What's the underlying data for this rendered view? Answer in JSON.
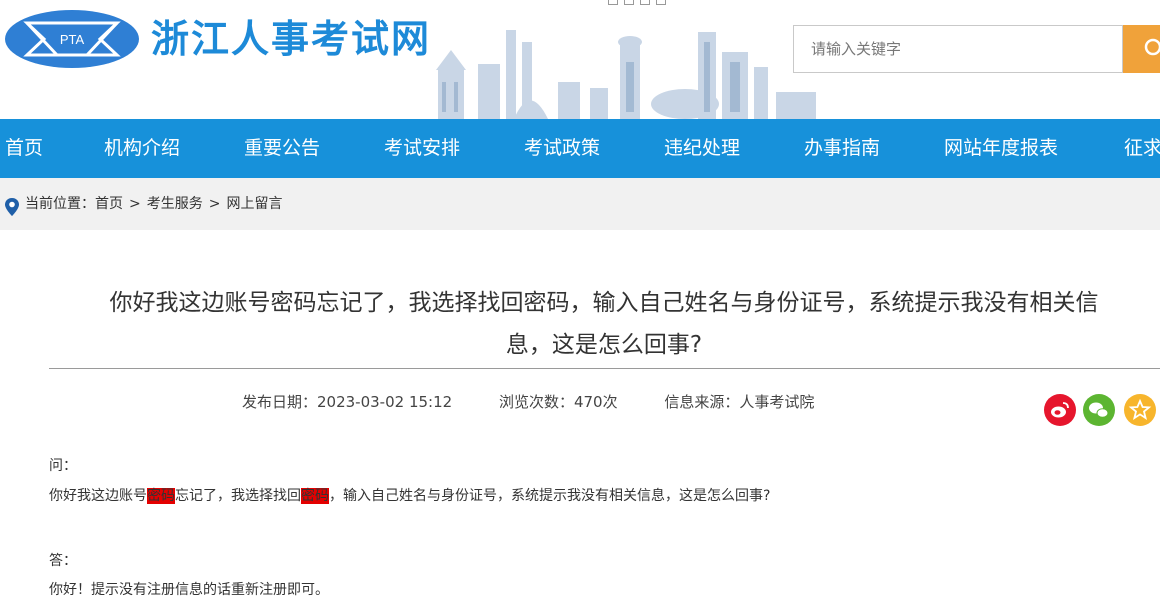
{
  "header": {
    "logo_text": "PTA",
    "site_title": "浙江人事考试网",
    "search_placeholder": "请输入关键字"
  },
  "nav": [
    {
      "label": "首页"
    },
    {
      "label": "机构介绍"
    },
    {
      "label": "重要公告"
    },
    {
      "label": "考试安排"
    },
    {
      "label": "考试政策"
    },
    {
      "label": "违纪处理"
    },
    {
      "label": "办事指南"
    },
    {
      "label": "网站年度报表"
    },
    {
      "label": "征求"
    }
  ],
  "breadcrumb": {
    "prefix": "当前位置：",
    "items": [
      "首页",
      "考生服务",
      "网上留言"
    ],
    "separator": ">"
  },
  "article": {
    "title_line1": "你好我这边账号密码忘记了，我选择找回密码，输入自己姓名与身份证号，系统提示我没有相关信",
    "title_line2": "息，这是怎么回事?",
    "publish_date": "发布日期：2023-03-02 15:12",
    "views": "浏览次数：470次",
    "source": "信息来源：人事考试院",
    "question_label": "问：",
    "question_parts": [
      "你好我这边账号",
      "密码",
      "忘记了，我选择找回",
      "密码",
      "，输入自己姓名与身份证号，系统提示我没有相关信息，这是怎么回事?"
    ],
    "answer_label": "答：",
    "answer_text": "你好！提示没有注册信息的话重新注册即可。"
  },
  "share_icons": [
    "weibo-icon",
    "wechat-icon",
    "favorite-icon"
  ],
  "colors": {
    "nav_bg": "#1791da",
    "title_blue": "#1d8ad8",
    "search_button": "#f0a23a",
    "highlight": "#e40000",
    "weibo": "#e6162d",
    "wechat": "#5cb531",
    "favorite": "#f7b52c"
  }
}
